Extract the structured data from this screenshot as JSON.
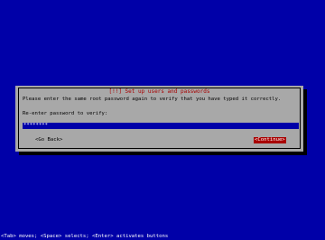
{
  "dialog": {
    "title": "[!!] Set up users and passwords",
    "prompt": "Please enter the same root password again to verify that you have typed it correctly.",
    "field_label": "Re-enter password to verify:",
    "password_masked": "********",
    "go_back_label": "<Go Back>",
    "continue_label": "<Continue>"
  },
  "footer": {
    "hint": "<Tab> moves; <Space> selects; <Enter> activates buttons"
  },
  "colors": {
    "background": "#0000a8",
    "dialog": "#a8a8a8",
    "title_text": "#a80000",
    "focused_button": "#a80000",
    "input_background": "#0000a8"
  }
}
